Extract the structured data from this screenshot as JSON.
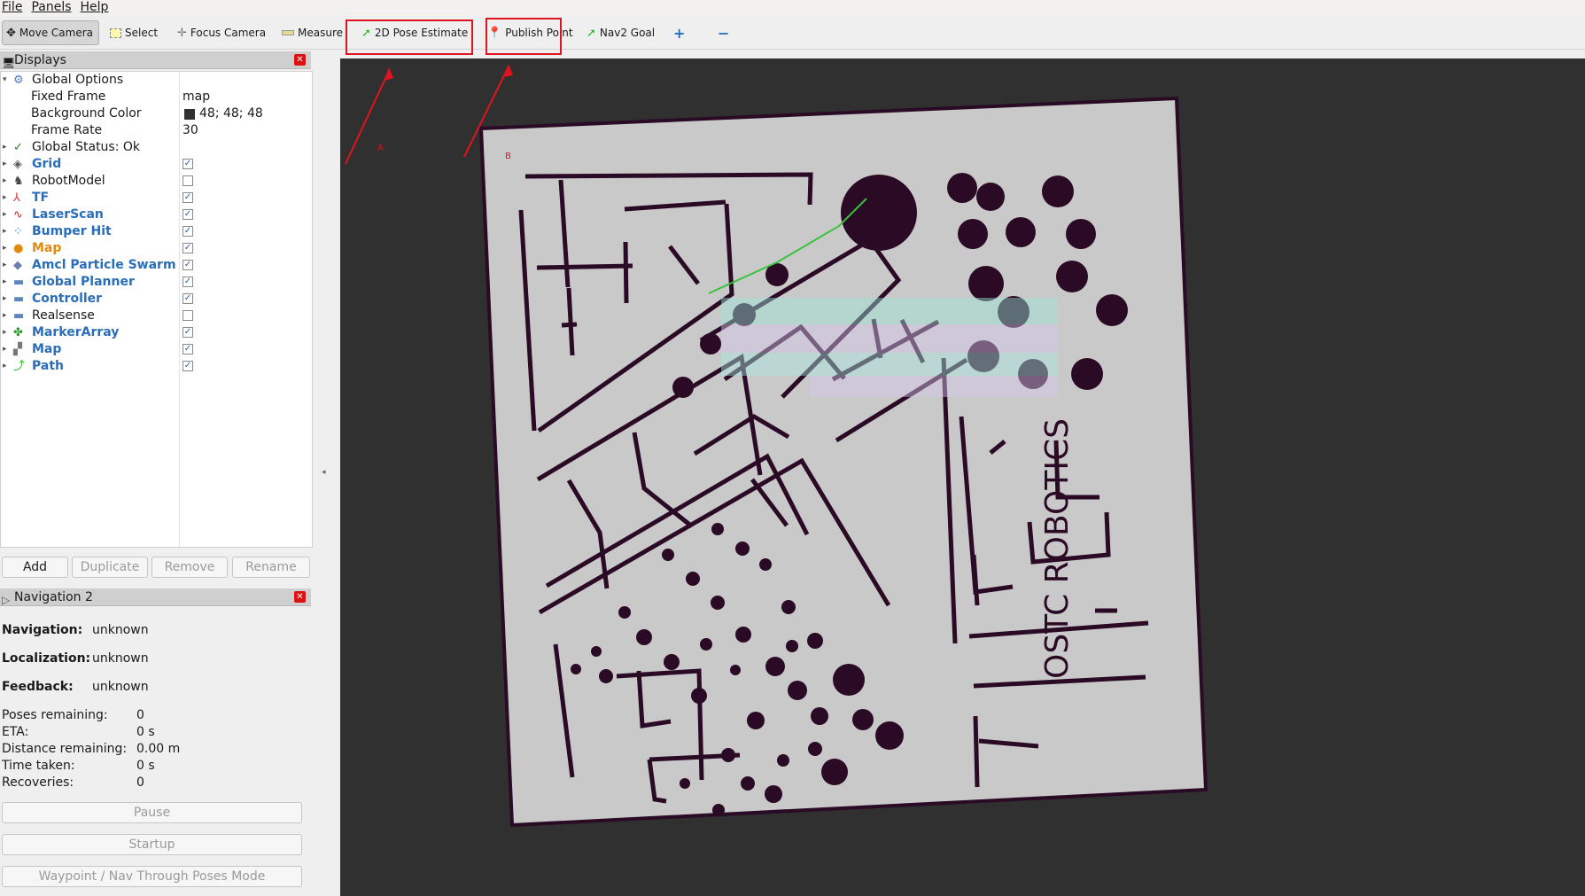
{
  "menu": {
    "file": "File",
    "panels": "Panels",
    "help": "Help"
  },
  "toolbar": {
    "move_camera": "Move Camera",
    "select": "Select",
    "focus_camera": "Focus Camera",
    "measure": "Measure",
    "pose_estimate": "2D Pose Estimate",
    "publish_point": "Publish Point",
    "nav2_goal": "Nav2 Goal"
  },
  "displays_panel": {
    "title": "Displays",
    "global_options": "Global Options",
    "fixed_frame_label": "Fixed Frame",
    "fixed_frame_value": "map",
    "bg_color_label": "Background Color",
    "bg_color_value": "48; 48; 48",
    "frame_rate_label": "Frame Rate",
    "frame_rate_value": "30",
    "global_status": "Global Status: Ok",
    "items": [
      {
        "label": "Grid",
        "checked": true
      },
      {
        "label": "RobotModel",
        "checked": false
      },
      {
        "label": "TF",
        "checked": true
      },
      {
        "label": "LaserScan",
        "checked": true
      },
      {
        "label": "Bumper Hit",
        "checked": true
      },
      {
        "label": "Map",
        "checked": true
      },
      {
        "label": "Amcl Particle Swarm",
        "checked": true
      },
      {
        "label": "Global Planner",
        "checked": true
      },
      {
        "label": "Controller",
        "checked": true
      },
      {
        "label": "Realsense",
        "checked": false
      },
      {
        "label": "MarkerArray",
        "checked": true
      },
      {
        "label": "Map",
        "checked": true
      },
      {
        "label": "Path",
        "checked": true
      }
    ],
    "add": "Add",
    "duplicate": "Duplicate",
    "remove": "Remove",
    "rename": "Rename"
  },
  "nav_panel": {
    "title": "Navigation 2",
    "navigation_label": "Navigation:",
    "navigation_value": "unknown",
    "localization_label": "Localization:",
    "localization_value": "unknown",
    "feedback_label": "Feedback:",
    "feedback_value": "unknown",
    "poses_label": "Poses remaining:",
    "poses_value": "0",
    "eta_label": "ETA:",
    "eta_value": "0 s",
    "distance_label": "Distance remaining:",
    "distance_value": "0.00 m",
    "time_label": "Time taken:",
    "time_value": "0 s",
    "recoveries_label": "Recoveries:",
    "recoveries_value": "0",
    "pause": "Pause",
    "startup": "Startup",
    "waypoint_mode": "Waypoint / Nav Through Poses Mode"
  },
  "annotations": {
    "a": "A",
    "b": "B"
  },
  "map_text": "OSTC ROBOTICS",
  "colors": {
    "highlight": "#e0141e",
    "viewport_bg": "#303030",
    "map_bg": "#c8c8c8",
    "wall": "#2a0a24"
  }
}
